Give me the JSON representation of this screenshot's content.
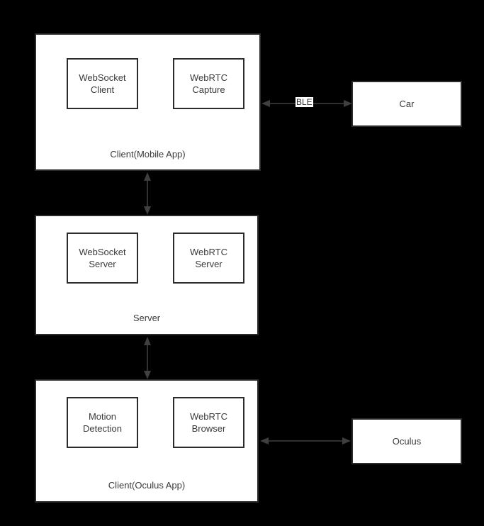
{
  "diagram": {
    "background_color": "#000000",
    "box_fill_color": "#ffffff",
    "stroke_color": "#2b2b2b",
    "text_color": "#3a3a3a",
    "arrow_color": "#3f3f3f",
    "groups": [
      {
        "id": "client-mobile",
        "label": "Client(Mobile App)",
        "modules": [
          {
            "id": "websocket-client",
            "label": "WebSocket\nClient"
          },
          {
            "id": "webrtc-capture",
            "label": "WebRTC\nCapture"
          }
        ]
      },
      {
        "id": "server",
        "label": "Server",
        "modules": [
          {
            "id": "websocket-server",
            "label": "WebSocket\nServer"
          },
          {
            "id": "webrtc-server",
            "label": "WebRTC\nServer"
          }
        ]
      },
      {
        "id": "client-oculus",
        "label": "Client(Oculus App)",
        "modules": [
          {
            "id": "motion-detection",
            "label": "Motion\nDetection"
          },
          {
            "id": "webrtc-browser",
            "label": "WebRTC\nBrowser"
          }
        ]
      }
    ],
    "endpoints": [
      {
        "id": "car",
        "label": "Car"
      },
      {
        "id": "oculus",
        "label": "Oculus"
      }
    ],
    "connectors": [
      {
        "id": "mobile-to-car",
        "from": "client-mobile",
        "to": "car",
        "orientation": "horizontal",
        "arrowheads": "both",
        "label": "BLE"
      },
      {
        "id": "mobile-to-server",
        "from": "client-mobile",
        "to": "server",
        "orientation": "vertical",
        "arrowheads": "both",
        "label": ""
      },
      {
        "id": "server-to-oculus-client",
        "from": "server",
        "to": "client-oculus",
        "orientation": "vertical",
        "arrowheads": "both",
        "label": ""
      },
      {
        "id": "oculus-client-to-oculus",
        "from": "client-oculus",
        "to": "oculus",
        "orientation": "horizontal",
        "arrowheads": "both",
        "label": ""
      }
    ]
  }
}
